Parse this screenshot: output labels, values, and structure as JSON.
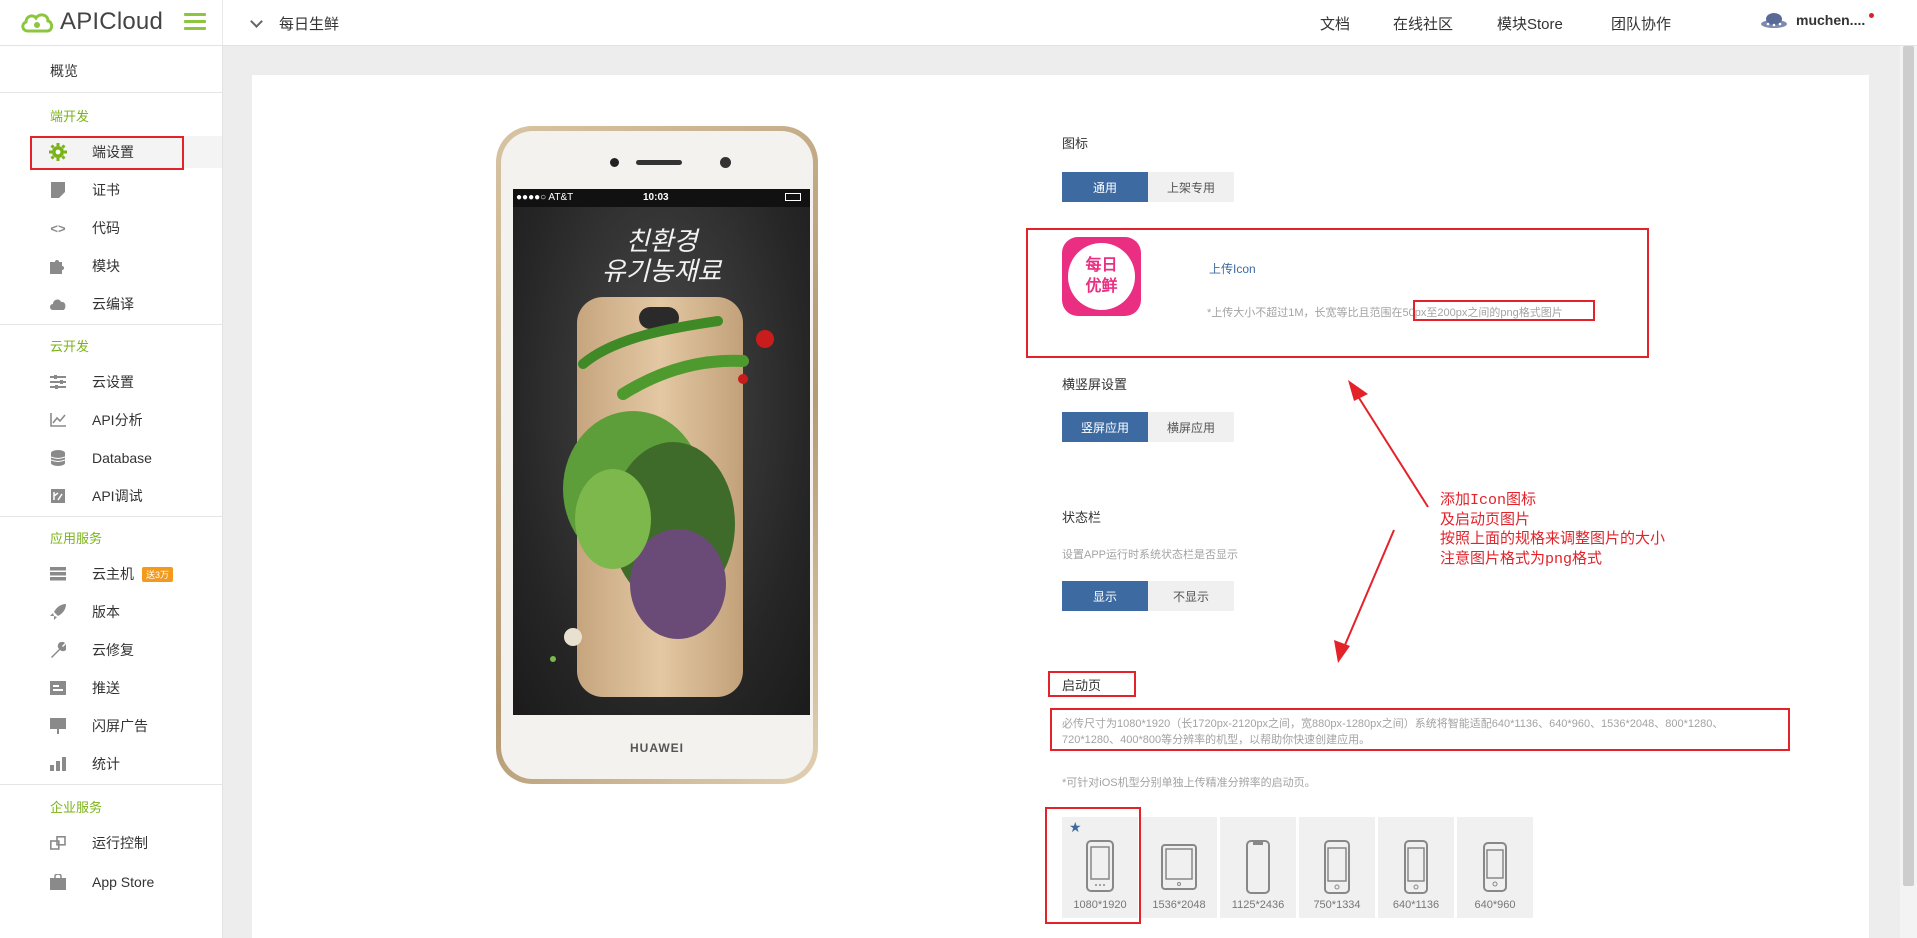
{
  "header": {
    "brand": "APICloud",
    "app_name": "每日生鲜",
    "nav": [
      "文档",
      "在线社区",
      "模块Store",
      "团队协作"
    ],
    "user": "muchen...."
  },
  "sidebar": {
    "overview": "概览",
    "sections": [
      {
        "title": "端开发",
        "items": [
          {
            "label": "端设置",
            "icon": "gear-icon",
            "active": true
          },
          {
            "label": "证书",
            "icon": "certificate-icon"
          },
          {
            "label": "代码",
            "icon": "code-icon"
          },
          {
            "label": "模块",
            "icon": "puzzle-icon"
          },
          {
            "label": "云编译",
            "icon": "cloud-icon"
          }
        ]
      },
      {
        "title": "云开发",
        "items": [
          {
            "label": "云设置",
            "icon": "sliders-icon"
          },
          {
            "label": "API分析",
            "icon": "line-chart-icon"
          },
          {
            "label": "Database",
            "icon": "database-icon"
          },
          {
            "label": "API调试",
            "icon": "debug-icon"
          }
        ]
      },
      {
        "title": "应用服务",
        "items": [
          {
            "label": "云主机",
            "icon": "server-icon",
            "badge": "送3万"
          },
          {
            "label": "版本",
            "icon": "rocket-icon"
          },
          {
            "label": "云修复",
            "icon": "wrench-icon"
          },
          {
            "label": "推送",
            "icon": "push-icon"
          },
          {
            "label": "闪屏广告",
            "icon": "ad-icon"
          },
          {
            "label": "统计",
            "icon": "bar-chart-icon"
          }
        ]
      },
      {
        "title": "企业服务",
        "items": [
          {
            "label": "运行控制",
            "icon": "control-icon"
          },
          {
            "label": "App Store",
            "icon": "bag-icon"
          }
        ]
      }
    ]
  },
  "phone": {
    "carrier": "●●●●○ AT&T",
    "time": "10:03",
    "brand": "HUAWEI",
    "poster_text_line1": "친환경",
    "poster_text_line2": "유기농재료"
  },
  "form": {
    "icon_section": {
      "title": "图标",
      "tabs": [
        {
          "label": "通用",
          "active": true
        },
        {
          "label": "上架专用",
          "active": false
        }
      ],
      "app_icon_text_line1": "每日",
      "app_icon_text_line2": "优鲜",
      "upload_label": "上传Icon",
      "upload_hint": "*上传大小不超过1M，长宽等比且范围在50px至200px之间的png格式图片"
    },
    "orientation": {
      "title": "横竖屏设置",
      "options": [
        {
          "label": "竖屏应用",
          "active": true
        },
        {
          "label": "横屏应用",
          "active": false
        }
      ]
    },
    "statusbar": {
      "title": "状态栏",
      "desc": "设置APP运行时系统状态栏是否显示",
      "options": [
        {
          "label": "显示",
          "active": true
        },
        {
          "label": "不显示",
          "active": false
        }
      ]
    },
    "launch": {
      "title": "启动页",
      "desc_line1": "必传尺寸为1080*1920（长1720px-2120px之间，宽880px-1280px之间）系统将智能适配640*1136、640*960、1536*2048、800*1280、",
      "desc_line2": "720*1280、400*800等分辨率的机型，以帮助你快速创建应用。",
      "ios_hint": "*可针对iOS机型分别单独上传精准分辨率的启动页。",
      "devices": [
        {
          "size": "1080*1920",
          "type": "android-phone-icon",
          "starred": true
        },
        {
          "size": "1536*2048",
          "type": "tablet-icon"
        },
        {
          "size": "1125*2436",
          "type": "iphone-x-icon"
        },
        {
          "size": "750*1334",
          "type": "iphone-icon"
        },
        {
          "size": "640*1136",
          "type": "iphone-icon"
        },
        {
          "size": "640*960",
          "type": "iphone-icon"
        }
      ]
    }
  },
  "annotation": {
    "line1": "添加Icon图标",
    "line2": "及启动页图片",
    "line3": "按照上面的规格来调整图片的大小",
    "line4": "注意图片格式为png格式"
  },
  "colors": {
    "accent_green": "#7ab317",
    "primary_blue": "#3d6aa1",
    "annotation_red": "#e3222a",
    "icon_pink": "#ea2f82"
  }
}
